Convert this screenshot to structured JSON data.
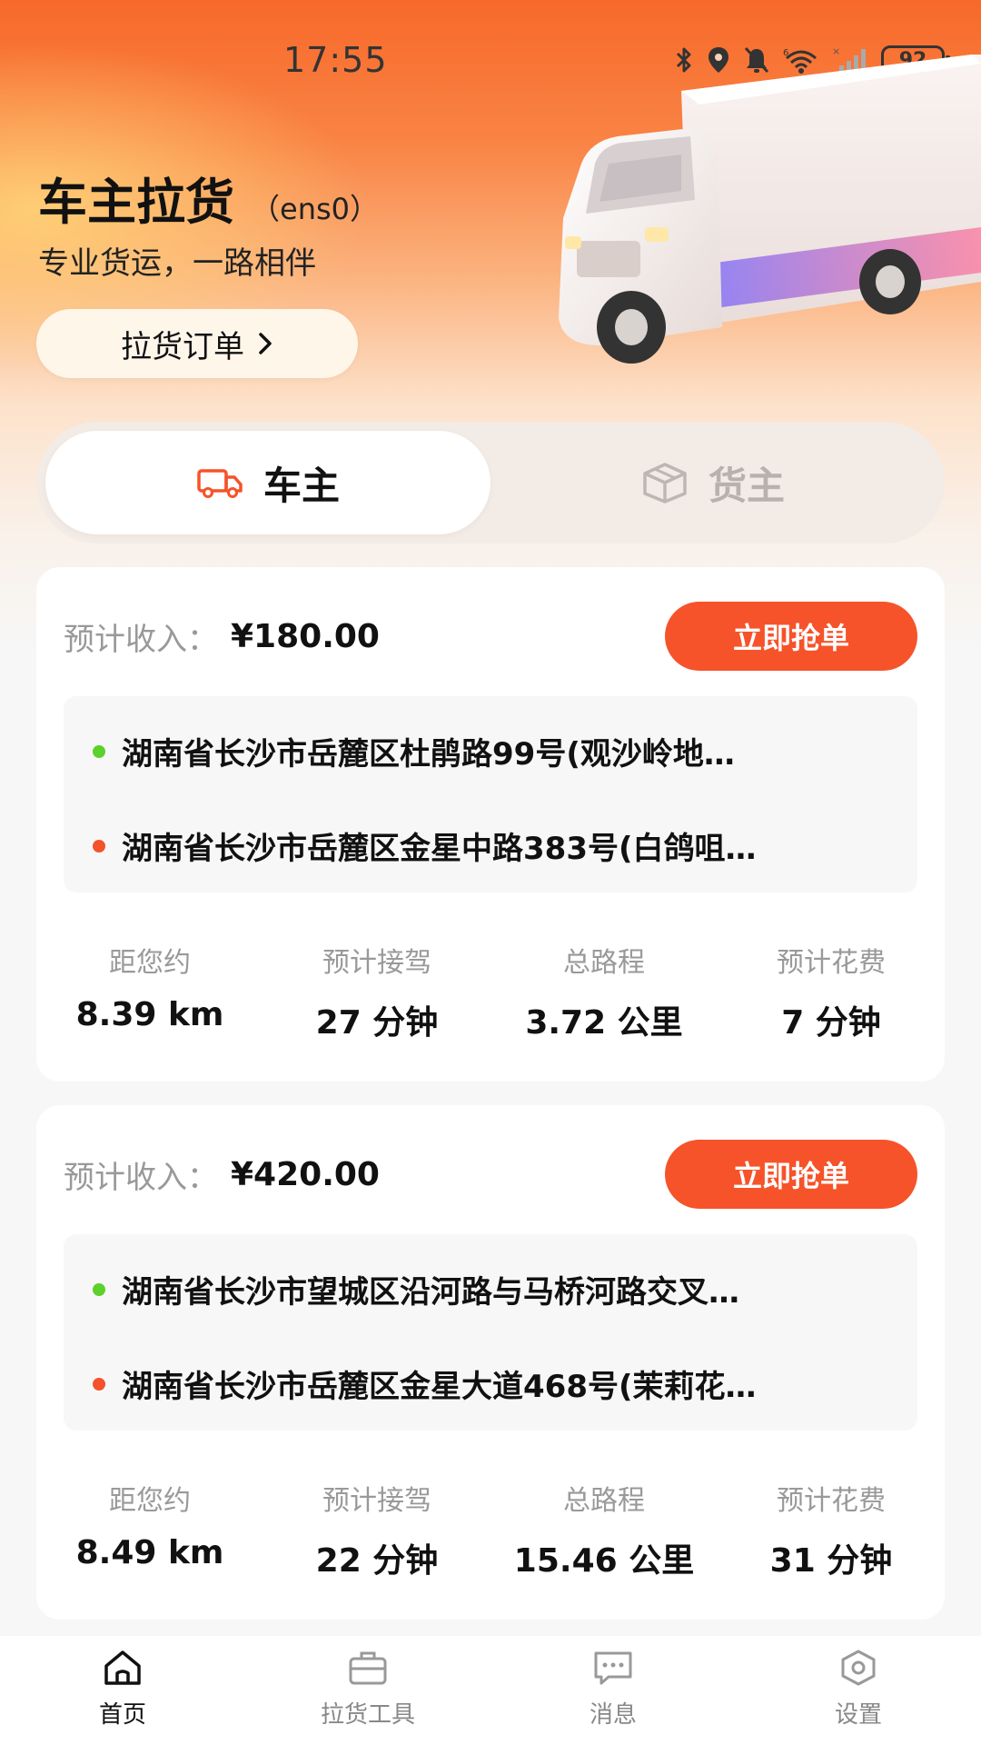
{
  "status_bar": {
    "time": "17:55",
    "battery": "92",
    "icons": [
      "bluetooth-icon",
      "location-icon",
      "mute-bell-icon",
      "wifi-icon",
      "cellular-signal-icon",
      "battery-icon"
    ]
  },
  "header": {
    "title": "车主拉货",
    "subtitle": "（ens0）",
    "tagline": "专业货运，一路相伴",
    "order_button": "拉货订单",
    "order_button_icon": "chevron-right-icon"
  },
  "tabs": [
    {
      "label": "车主",
      "icon": "truck-icon",
      "active": true
    },
    {
      "label": "货主",
      "icon": "box-icon",
      "active": false
    }
  ],
  "orders": [
    {
      "income_label": "预计收入：",
      "income": "¥180.00",
      "action": "立即抢单",
      "from": "湖南省长沙市岳麓区杜鹃路99号(观沙岭地…",
      "to": "湖南省长沙市岳麓区金星中路383号(白鸽咀…",
      "stats": [
        {
          "label": "距您约",
          "value": "8.39 km"
        },
        {
          "label": "预计接驾",
          "value": "27 分钟"
        },
        {
          "label": "总路程",
          "value": "3.72 公里"
        },
        {
          "label": "预计花费",
          "value": "7 分钟"
        }
      ]
    },
    {
      "income_label": "预计收入：",
      "income": "¥420.00",
      "action": "立即抢单",
      "from": "湖南省长沙市望城区沿河路与马桥河路交叉…",
      "to": "湖南省长沙市岳麓区金星大道468号(茉莉花…",
      "stats": [
        {
          "label": "距您约",
          "value": "8.49 km"
        },
        {
          "label": "预计接驾",
          "value": "22 分钟"
        },
        {
          "label": "总路程",
          "value": "15.46 公里"
        },
        {
          "label": "预计花费",
          "value": "31 分钟"
        }
      ]
    }
  ],
  "bottom_nav": [
    {
      "label": "首页",
      "icon": "home-icon",
      "active": true
    },
    {
      "label": "拉货工具",
      "icon": "briefcase-icon",
      "active": false
    },
    {
      "label": "消息",
      "icon": "message-icon",
      "active": false
    },
    {
      "label": "设置",
      "icon": "settings-icon",
      "active": false
    }
  ],
  "colors": {
    "accent": "#f6532a",
    "origin_dot": "#5bd12a",
    "destination_dot": "#f4522a",
    "header_gradient_top": "#f7692a"
  }
}
